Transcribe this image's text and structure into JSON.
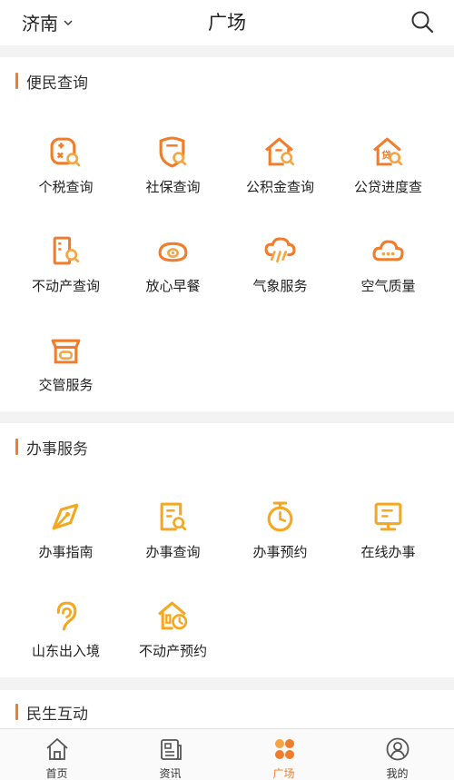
{
  "header": {
    "city": "济南",
    "title": "广场"
  },
  "sections": [
    {
      "title": "便民查询",
      "items": [
        {
          "label": "个税查询",
          "icon": "tax-search-icon"
        },
        {
          "label": "社保查询",
          "icon": "social-security-search-icon"
        },
        {
          "label": "公积金查询",
          "icon": "housing-fund-search-icon"
        },
        {
          "label": "公贷进度查",
          "icon": "loan-progress-icon"
        },
        {
          "label": "不动产查询",
          "icon": "real-estate-search-icon"
        },
        {
          "label": "放心早餐",
          "icon": "breakfast-icon"
        },
        {
          "label": "气象服务",
          "icon": "weather-icon"
        },
        {
          "label": "空气质量",
          "icon": "air-quality-icon"
        },
        {
          "label": "交管服务",
          "icon": "traffic-service-icon"
        }
      ]
    },
    {
      "title": "办事服务",
      "items": [
        {
          "label": "办事指南",
          "icon": "compass-guide-icon"
        },
        {
          "label": "办事查询",
          "icon": "document-search-icon"
        },
        {
          "label": "办事预约",
          "icon": "stopwatch-icon"
        },
        {
          "label": "在线办事",
          "icon": "monitor-icon"
        },
        {
          "label": "山东出入境",
          "icon": "ear-icon"
        },
        {
          "label": "不动产预约",
          "icon": "house-clock-icon"
        }
      ]
    },
    {
      "title": "民生互动",
      "items": []
    }
  ],
  "tabbar": {
    "items": [
      {
        "label": "首页",
        "icon": "home-icon"
      },
      {
        "label": "资讯",
        "icon": "news-icon"
      },
      {
        "label": "广场",
        "icon": "square-dots-icon",
        "active": true
      },
      {
        "label": "我的",
        "icon": "user-icon"
      }
    ]
  },
  "colors": {
    "accent": "#f07d2b",
    "accent_light": "#f6a544",
    "service_yellow": "#f5a71f"
  }
}
